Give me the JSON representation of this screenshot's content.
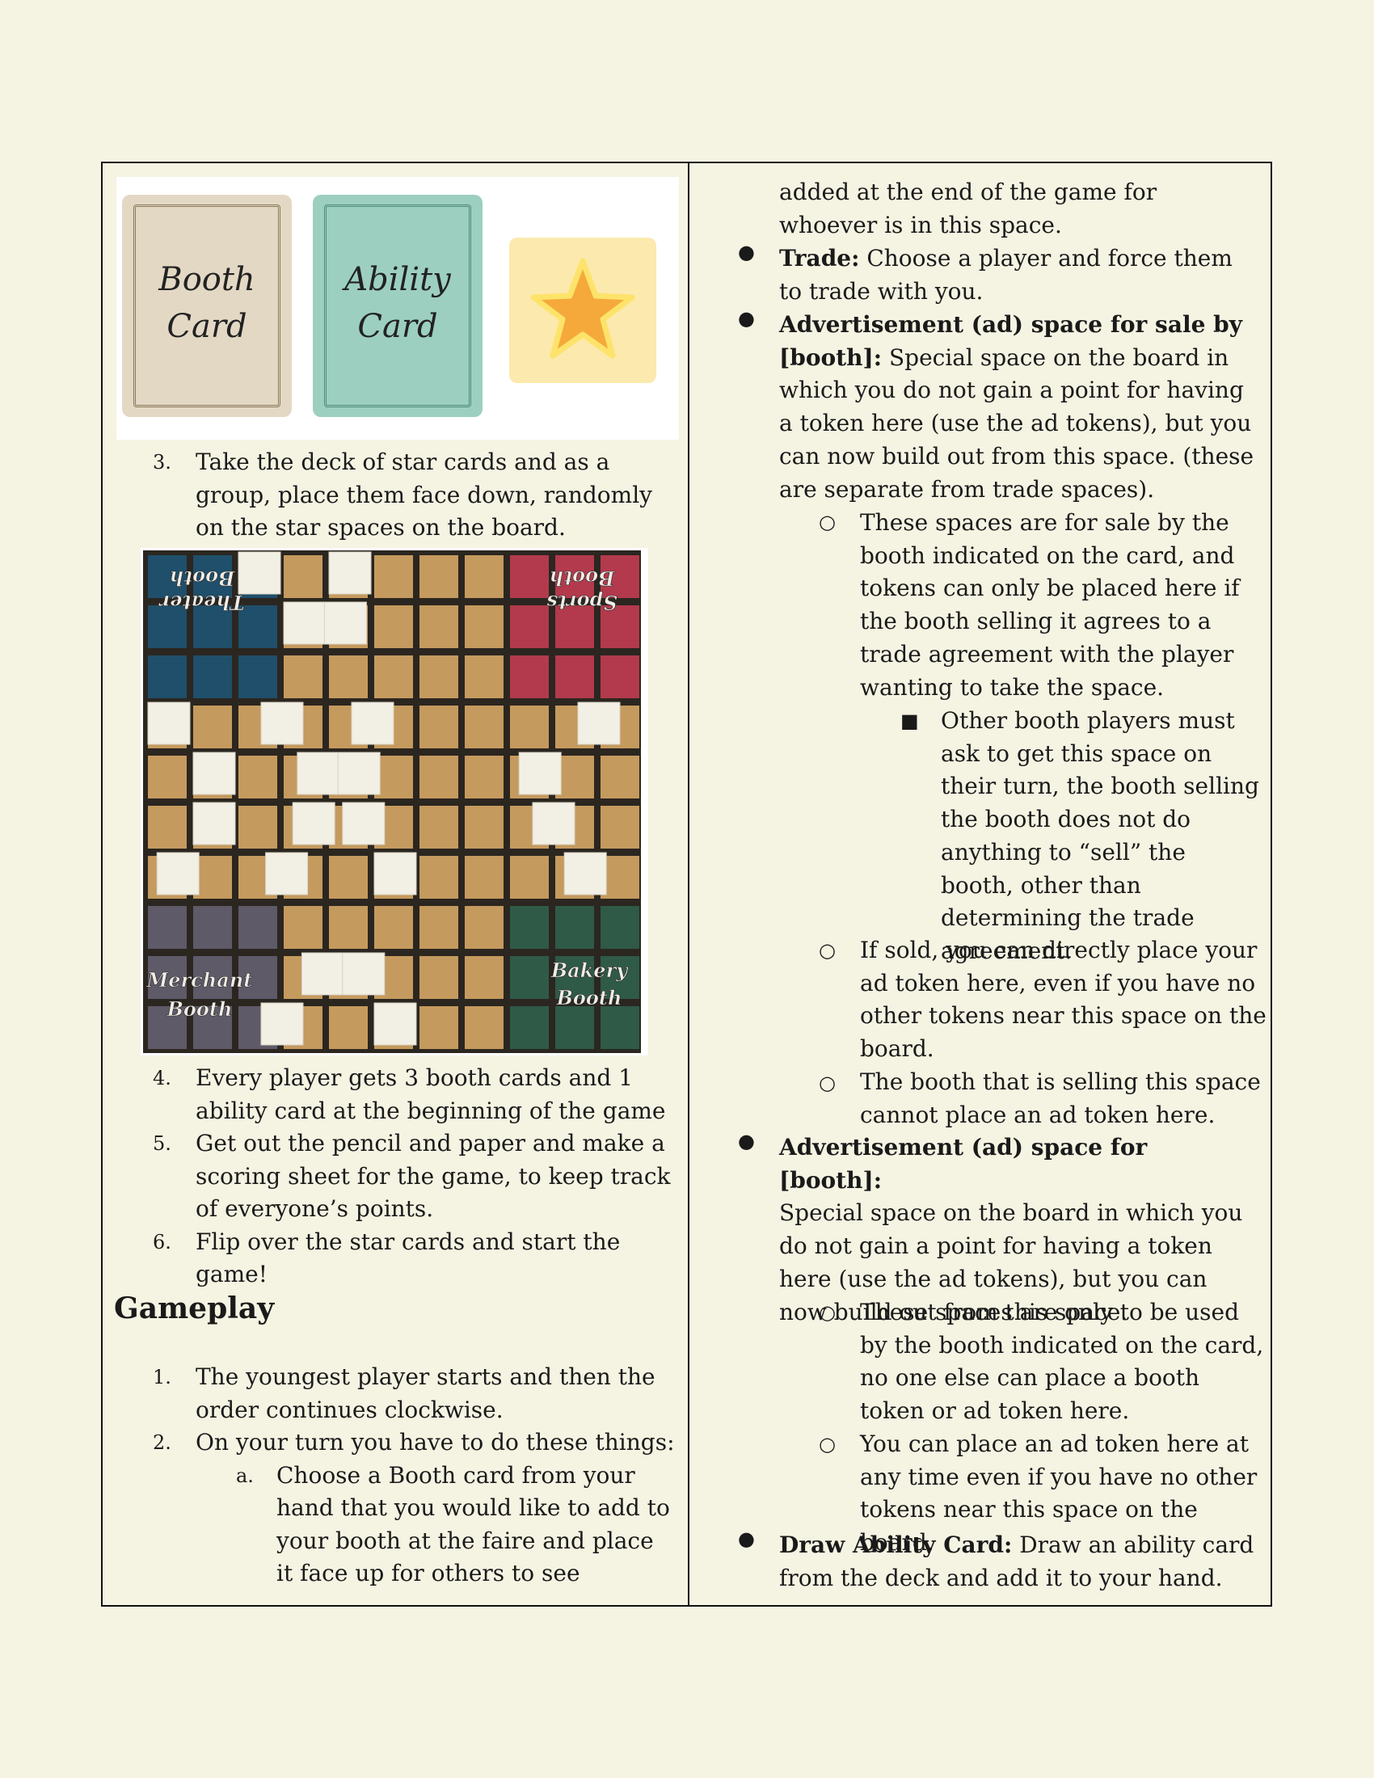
{
  "left": {
    "cards": {
      "booth": {
        "line1": "Booth",
        "line2": "Card"
      },
      "ability": {
        "line1": "Ability",
        "line2": "Card"
      },
      "star_icon": "star-icon"
    },
    "setup_steps_a": [
      {
        "num": "3.",
        "text": "Take the deck of star cards and as a group, place them face down, randomly on the star spaces on the board."
      }
    ],
    "board": {
      "theater": {
        "line1": "Theater",
        "line2": "Booth"
      },
      "sports": {
        "line1": "Sports",
        "line2": "Booth"
      },
      "merchant": {
        "line1": "Merchant",
        "line2": "Booth"
      },
      "bakery": {
        "line1": "Bakery",
        "line2": "Booth"
      },
      "colors": {
        "theater": "#1f4f6a",
        "sports": "#b23a4c",
        "merchant": "#5f5a68",
        "bakery": "#2f5a48",
        "tile": "#c59a5e"
      }
    },
    "setup_steps_b": [
      {
        "num": "4.",
        "text": "Every player gets 3 booth cards and 1 ability card at the beginning of the game"
      },
      {
        "num": "5.",
        "text": "Get out the pencil and paper and make a scoring sheet for the game, to keep track of everyone’s points."
      },
      {
        "num": "6.",
        "text": "Flip over the star cards and start the game!"
      }
    ],
    "gameplay_heading": "Gameplay",
    "gameplay_steps": [
      {
        "num": "1.",
        "text": "The youngest player starts and then the order continues clockwise."
      },
      {
        "num": "2.",
        "text": "On your turn you have to do these things:"
      }
    ],
    "sub_step": {
      "num": "a.",
      "text": "Choose a Booth card from your hand that you would like to add to your booth at the faire and place it face up for others to see"
    }
  },
  "right": {
    "continuation": "added at the end of the game for whoever is in this space.",
    "trade_label": "Trade:",
    "trade_text": " Choose a player and force them to trade with you.",
    "ad_sale_label": "Advertisement (ad) space for sale by [booth]:",
    "ad_sale_text": " Special space on the board in which you do not gain a point for having a token here (use the ad tokens), but you can now build out from this space. (these are separate from trade spaces).",
    "ad_sale_sub1": "These spaces are for sale by the booth indicated on the card, and tokens can only be placed here if the booth selling it agrees to a trade agreement with the player wanting to take the space.",
    "ad_sale_sub1_sub": "Other booth players must ask to get this space on their turn, the booth selling the booth does not do anything to “sell” the booth, other than determining the trade agreement.",
    "ad_sale_sub2": "If sold, you can directly place your ad token here, even if you have no other tokens near this space on the board.",
    "ad_sale_sub3": "The booth that is selling this space cannot place an ad token here.",
    "ad_booth_label": "Advertisement (ad) space for [booth]:",
    "ad_booth_text": "Special space on the board in which you do not gain a point for having a token here (use the ad tokens), but you can now build out from this space.",
    "ad_booth_sub1": "These spaces are only to be used by the booth indicated on the card, no one else can place a booth token or ad token here.",
    "ad_booth_sub2": "You can place an ad token here at any time even if you have no other tokens near this space on the board.",
    "draw_label": "Draw Ability Card:",
    "draw_text": "  Draw an ability card from the deck and add it to your hand.",
    "bullets": {
      "disc": "●",
      "circle": "○",
      "square": "■"
    }
  }
}
